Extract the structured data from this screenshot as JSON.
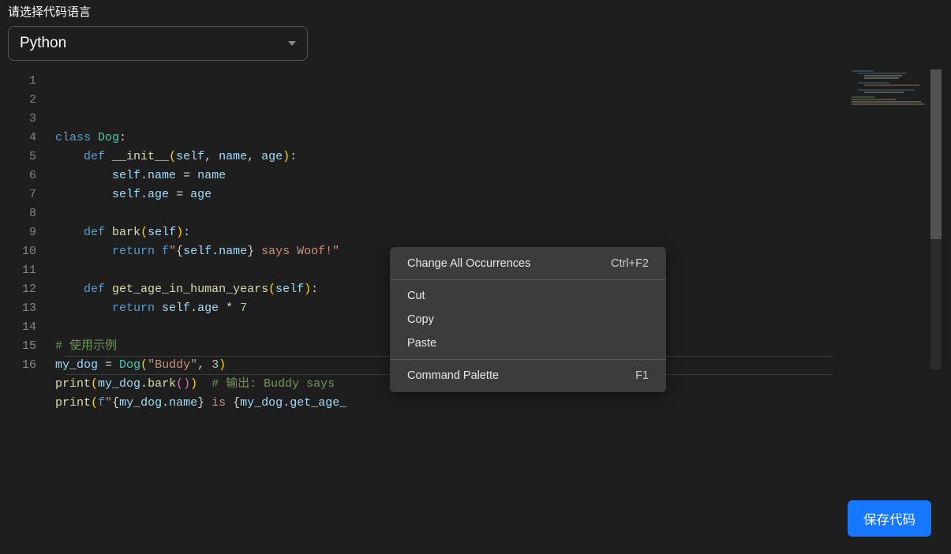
{
  "header": {
    "label": "请选择代码语言"
  },
  "language": {
    "selected": "Python"
  },
  "editor": {
    "totalLines": 16,
    "currentLine": 16,
    "tokens": [
      [
        {
          "t": "kw",
          "v": "class"
        },
        {
          "t": "op",
          "v": " "
        },
        {
          "t": "cls",
          "v": "Dog"
        },
        {
          "t": "pun",
          "v": ":"
        }
      ],
      [
        {
          "t": "pun",
          "v": "    "
        },
        {
          "t": "kw",
          "v": "def"
        },
        {
          "t": "op",
          "v": " "
        },
        {
          "t": "fn",
          "v": "__init__"
        },
        {
          "t": "par",
          "v": "("
        },
        {
          "t": "self",
          "v": "self"
        },
        {
          "t": "pun",
          "v": ", "
        },
        {
          "t": "var",
          "v": "name"
        },
        {
          "t": "pun",
          "v": ", "
        },
        {
          "t": "var",
          "v": "age"
        },
        {
          "t": "par",
          "v": ")"
        },
        {
          "t": "pun",
          "v": ":"
        }
      ],
      [
        {
          "t": "pun",
          "v": "        "
        },
        {
          "t": "self",
          "v": "self"
        },
        {
          "t": "pun",
          "v": "."
        },
        {
          "t": "var",
          "v": "name"
        },
        {
          "t": "op",
          "v": " = "
        },
        {
          "t": "var",
          "v": "name"
        }
      ],
      [
        {
          "t": "pun",
          "v": "        "
        },
        {
          "t": "self",
          "v": "self"
        },
        {
          "t": "pun",
          "v": "."
        },
        {
          "t": "var",
          "v": "age"
        },
        {
          "t": "op",
          "v": " = "
        },
        {
          "t": "var",
          "v": "age"
        }
      ],
      [],
      [
        {
          "t": "pun",
          "v": "    "
        },
        {
          "t": "kw",
          "v": "def"
        },
        {
          "t": "op",
          "v": " "
        },
        {
          "t": "fn",
          "v": "bark"
        },
        {
          "t": "par",
          "v": "("
        },
        {
          "t": "self",
          "v": "self"
        },
        {
          "t": "par",
          "v": ")"
        },
        {
          "t": "pun",
          "v": ":"
        }
      ],
      [
        {
          "t": "pun",
          "v": "        "
        },
        {
          "t": "kw",
          "v": "return"
        },
        {
          "t": "op",
          "v": " "
        },
        {
          "t": "kw",
          "v": "f"
        },
        {
          "t": "str",
          "v": "\""
        },
        {
          "t": "pun",
          "v": "{"
        },
        {
          "t": "self",
          "v": "self"
        },
        {
          "t": "pun",
          "v": "."
        },
        {
          "t": "var",
          "v": "name"
        },
        {
          "t": "pun",
          "v": "}"
        },
        {
          "t": "str",
          "v": " says Woof!\""
        }
      ],
      [],
      [
        {
          "t": "pun",
          "v": "    "
        },
        {
          "t": "kw",
          "v": "def"
        },
        {
          "t": "op",
          "v": " "
        },
        {
          "t": "fn",
          "v": "get_age_in_human_years"
        },
        {
          "t": "par",
          "v": "("
        },
        {
          "t": "self",
          "v": "self"
        },
        {
          "t": "par",
          "v": ")"
        },
        {
          "t": "pun",
          "v": ":"
        }
      ],
      [
        {
          "t": "pun",
          "v": "        "
        },
        {
          "t": "kw",
          "v": "return"
        },
        {
          "t": "op",
          "v": " "
        },
        {
          "t": "self",
          "v": "self"
        },
        {
          "t": "pun",
          "v": "."
        },
        {
          "t": "var",
          "v": "age"
        },
        {
          "t": "op",
          "v": " * "
        },
        {
          "t": "num",
          "v": "7"
        }
      ],
      [],
      [
        {
          "t": "cmt",
          "v": "# 使用示例"
        }
      ],
      [
        {
          "t": "var",
          "v": "my_dog"
        },
        {
          "t": "op",
          "v": " = "
        },
        {
          "t": "cls",
          "v": "Dog"
        },
        {
          "t": "par",
          "v": "("
        },
        {
          "t": "str",
          "v": "\"Buddy\""
        },
        {
          "t": "pun",
          "v": ", "
        },
        {
          "t": "num",
          "v": "3"
        },
        {
          "t": "par",
          "v": ")"
        }
      ],
      [
        {
          "t": "fn",
          "v": "print"
        },
        {
          "t": "par",
          "v": "("
        },
        {
          "t": "var",
          "v": "my_dog"
        },
        {
          "t": "pun",
          "v": "."
        },
        {
          "t": "fn",
          "v": "bark"
        },
        {
          "t": "par2",
          "v": "()"
        },
        {
          "t": "par",
          "v": ")"
        },
        {
          "t": "op",
          "v": "  "
        },
        {
          "t": "cmt",
          "v": "# 输出: Buddy says "
        }
      ],
      [
        {
          "t": "fn",
          "v": "print"
        },
        {
          "t": "par",
          "v": "("
        },
        {
          "t": "kw",
          "v": "f"
        },
        {
          "t": "str",
          "v": "\""
        },
        {
          "t": "pun",
          "v": "{"
        },
        {
          "t": "var",
          "v": "my_dog"
        },
        {
          "t": "pun",
          "v": "."
        },
        {
          "t": "var",
          "v": "name"
        },
        {
          "t": "pun",
          "v": "}"
        },
        {
          "t": "str",
          "v": " is "
        },
        {
          "t": "pun",
          "v": "{"
        },
        {
          "t": "var",
          "v": "my_dog"
        },
        {
          "t": "pun",
          "v": "."
        },
        {
          "t": "var",
          "v": "get_age_"
        }
      ],
      []
    ]
  },
  "contextMenu": {
    "groups": [
      [
        {
          "label": "Change All Occurrences",
          "shortcut": "Ctrl+F2"
        }
      ],
      [
        {
          "label": "Cut",
          "shortcut": ""
        },
        {
          "label": "Copy",
          "shortcut": ""
        },
        {
          "label": "Paste",
          "shortcut": ""
        }
      ],
      [
        {
          "label": "Command Palette",
          "shortcut": "F1"
        }
      ]
    ]
  },
  "buttons": {
    "save": "保存代码"
  }
}
